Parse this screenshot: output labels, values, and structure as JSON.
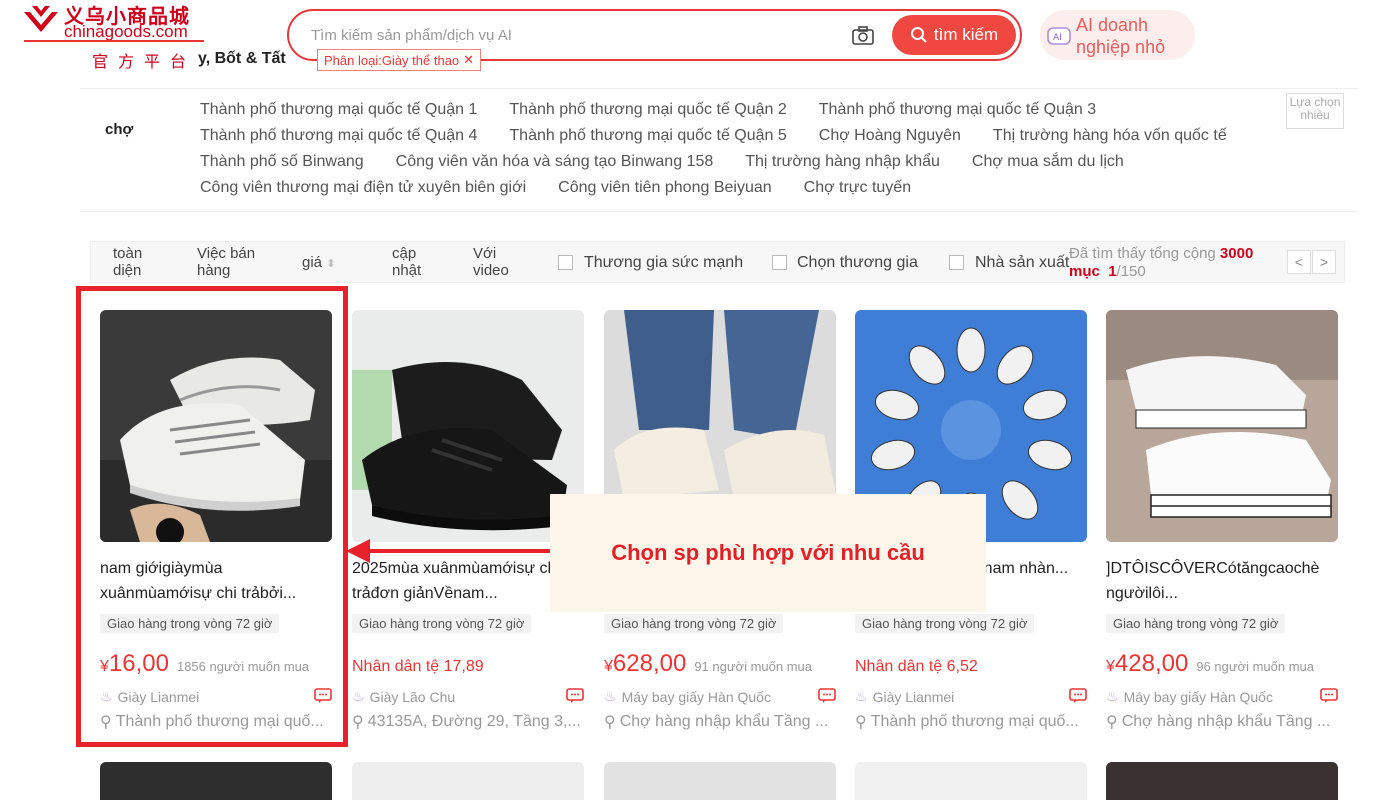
{
  "header": {
    "logo_cn": "义乌小商品城",
    "logo_en": "chinagoods.com",
    "logo_official": "官方平台",
    "category_label": "y, Bốt & Tất",
    "search_placeholder": "Tìm kiếm sản phẩm/dịch vụ AI",
    "search_button": "tìm kiếm",
    "filter_chip": "Phân loại:Giày thể thao",
    "ai_button_line1": "AI doanh",
    "ai_button_line2": "nghiệp nhỏ"
  },
  "market": {
    "label": "chợ",
    "multi_select": "Lựa chọn nhiều",
    "rows": [
      [
        "Thành phố thương mại quốc tế Quận 1",
        "Thành phố thương mại quốc tế Quận 2",
        "Thành phố thương mại quốc tế Quận 3"
      ],
      [
        "Thành phố thương mại quốc tế Quận 4",
        "Thành phố thương mại quốc tế Quận 5",
        "Chợ Hoàng Nguyên",
        "Thị trường hàng hóa vốn quốc tế"
      ],
      [
        "Thành phố số Binwang",
        "Công viên văn hóa và sáng tạo Binwang 158",
        "Thị trường hàng nhập khẩu",
        "Chợ mua sắm du lịch"
      ],
      [
        "Công viên thương mại điện tử xuyên biên giới",
        "Công viên tiên phong Beiyuan",
        "Chợ trực tuyến"
      ]
    ]
  },
  "sortbar": {
    "overall": "toàn diện",
    "sales": "Việc bán hàng",
    "price": "giá",
    "updated": "cập nhật",
    "with_video": "Với video",
    "check1": "Thương gia sức mạnh",
    "check2": "Chọn thương gia",
    "check3": "Nhà sản xuất",
    "found_prefix": "Đã tìm thấy tổng cộng",
    "found_count": "3000",
    "found_unit": "mục",
    "page_current": "1",
    "page_total": "/150",
    "prev": "<",
    "next": ">"
  },
  "products": [
    {
      "title": "nam giớigiàymùa xuânmùamớisự chi trảbởi...",
      "badge": "Giao hàng trong vòng 72 giờ",
      "price_symbol": "¥",
      "price": "16,00",
      "want": "1856 người muốn mua",
      "price_text": "",
      "seller": "Giày Lianmei",
      "location": "Thành phố thương mại quố..."
    },
    {
      "title": "2025mùa xuânmùamớisự chi trảđơn giảnVềnam...",
      "badge": "Giao hàng trong vòng 72 giờ",
      "price_symbol": "",
      "price": "",
      "want": "",
      "price_text": "Nhân dân tệ 17,89",
      "seller": "Giày Lão Chu",
      "location": "43135A, Đường 29, Tầng 3,..."
    },
    {
      "title": "",
      "badge": "Giao hàng trong vòng 72 giờ",
      "price_symbol": "¥",
      "price": "628,00",
      "want": "91 người muốn mua",
      "price_text": "",
      "seller": "Máy bay giấy Hàn Quốc",
      "location": "Chợ hàng nhập khẩu Tầng ..."
    },
    {
      "title": "trảnam nhàn...",
      "badge": "Giao hàng trong vòng 72 giờ",
      "price_symbol": "",
      "price": "",
      "want": "",
      "price_text": "Nhân dân tệ 6,52",
      "seller": "Giày Lianmei",
      "location": "Thành phố thương mại quố..."
    },
    {
      "title": "]DTÔISCÔVERCótăngcaochè ngườilôi...",
      "badge": "Giao hàng trong vòng 72 giờ",
      "price_symbol": "¥",
      "price": "428,00",
      "want": "96 người muốn mua",
      "price_text": "",
      "seller": "Máy bay giấy Hàn Quốc",
      "location": "Chợ hàng nhập khẩu Tầng ..."
    }
  ],
  "annotation": {
    "callout": "Chọn sp phù hợp với nhu cầu"
  },
  "colors": {
    "brand_red": "#e8363b",
    "price_red": "#e33333",
    "highlight_red": "#e8212b"
  }
}
